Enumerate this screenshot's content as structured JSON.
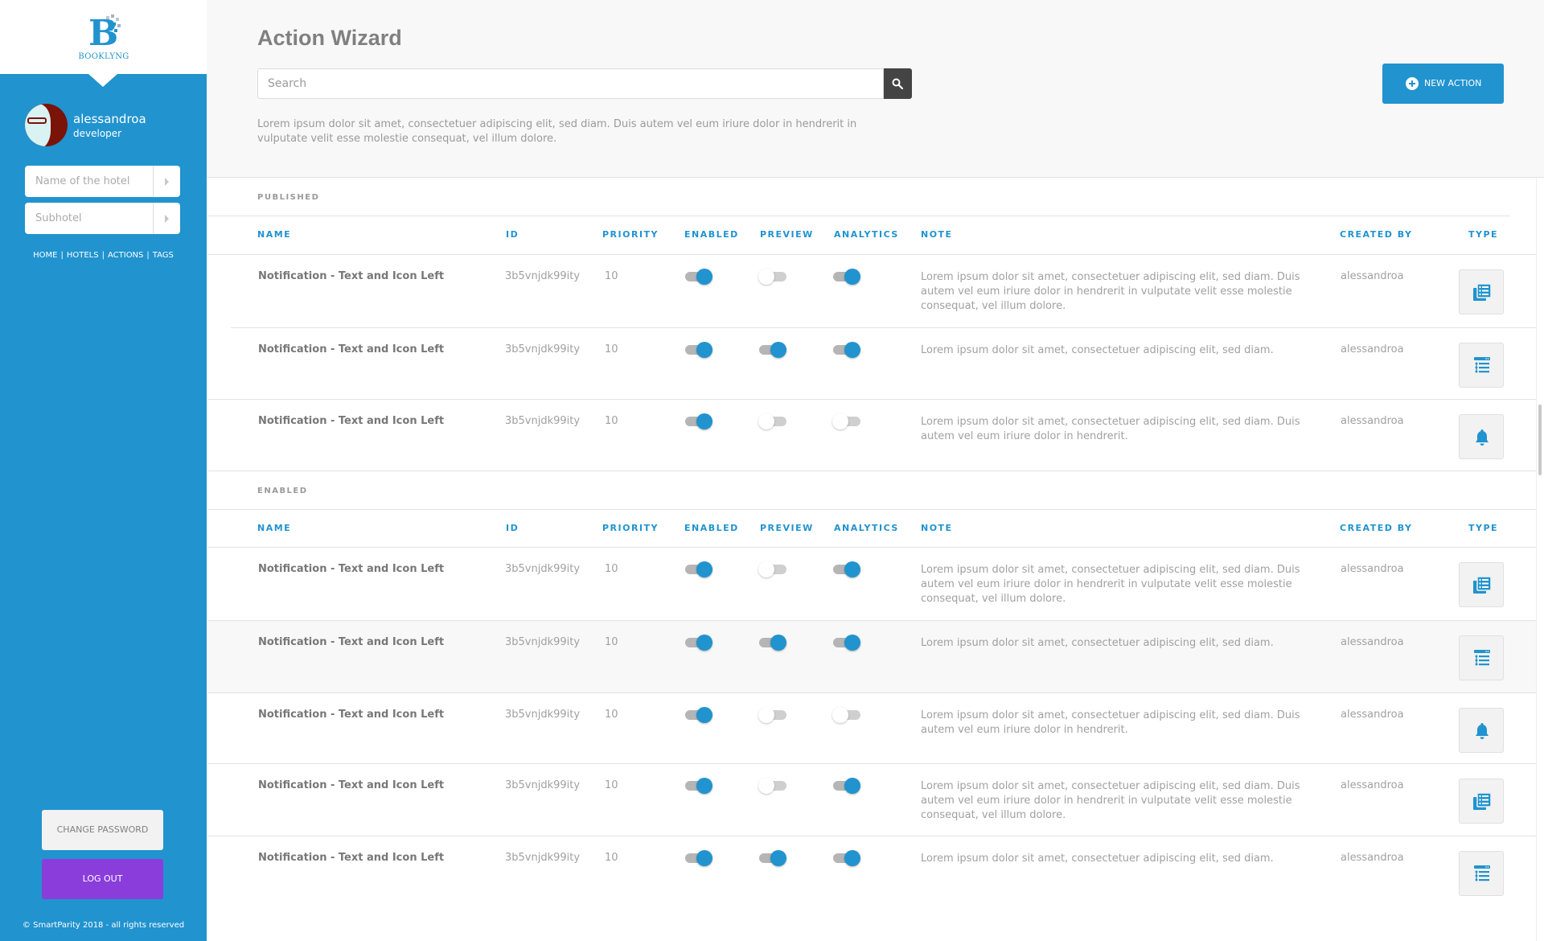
{
  "sidebar": {
    "logo_text": "BOOKLYNG",
    "user": {
      "name": "alessandroa",
      "role": "developer"
    },
    "hotel_input": {
      "placeholder": "Name of the hotel",
      "value": ""
    },
    "subhotel_input": {
      "placeholder": "Subhotel",
      "value": ""
    },
    "nav": [
      {
        "label": "HOME"
      },
      {
        "label": "HOTELS"
      },
      {
        "label": "ACTIONS"
      },
      {
        "label": "TAGS"
      }
    ],
    "nav_separator": "|",
    "change_password_label": "CHANGE PASSWORD",
    "logout_label": "LOG OUT",
    "copyright": "© SmartParity 2018 - all rights reserved"
  },
  "header": {
    "title": "Action Wizard",
    "search": {
      "placeholder": "Search",
      "value": ""
    },
    "description": "Lorem ipsum dolor sit amet, consectetuer adipiscing elit, sed diam. Duis autem vel eum iriure dolor in hendrerit in vulputate velit esse molestie consequat, vel illum dolore.",
    "new_action_label": "NEW ACTION"
  },
  "columns": {
    "name": "NAME",
    "id": "ID",
    "priority": "PRIORITY",
    "enabled": "ENABLED",
    "preview": "PREVIEW",
    "analytics": "ANALYTICS",
    "note": "NOTE",
    "created_by": "CREATED BY",
    "type": "TYPE"
  },
  "colors": {
    "brand_blue": "#2193cf",
    "logout_purple": "#8a3ddb",
    "toggle_on": "#2193cf",
    "toggle_off": "#ffffff"
  },
  "sections": [
    {
      "label": "PUBLISHED",
      "rows": [
        {
          "name": "Notification - Text and Icon Left",
          "id": "3b5vnjdk99ity",
          "priority": "10",
          "enabled": true,
          "preview": false,
          "analytics": true,
          "note": "Lorem ipsum dolor sit amet, consectetuer adipiscing elit, sed diam. Duis autem vel eum iriure dolor in hendrerit in vulputate velit esse molestie consequat, vel illum dolore.",
          "created_by": "alessandroa",
          "type_icon": "layers-list-icon"
        },
        {
          "name": "Notification - Text and Icon Left",
          "id": "3b5vnjdk99ity",
          "priority": "10",
          "enabled": true,
          "preview": true,
          "analytics": true,
          "note": "Lorem ipsum dolor sit amet, consectetuer adipiscing elit, sed diam.",
          "created_by": "alessandroa",
          "type_icon": "window-list-icon"
        },
        {
          "name": "Notification - Text and Icon Left",
          "id": "3b5vnjdk99ity",
          "priority": "10",
          "enabled": true,
          "preview": false,
          "analytics": false,
          "note": "Lorem ipsum dolor sit amet, consectetuer adipiscing elit, sed diam. Duis autem vel eum iriure dolor in hendrerit.",
          "created_by": "alessandroa",
          "type_icon": "bell-icon"
        }
      ]
    },
    {
      "label": "ENABLED",
      "rows": [
        {
          "name": "Notification - Text and Icon Left",
          "id": "3b5vnjdk99ity",
          "priority": "10",
          "enabled": true,
          "preview": false,
          "analytics": true,
          "note": "Lorem ipsum dolor sit amet, consectetuer adipiscing elit, sed diam. Duis autem vel eum iriure dolor in hendrerit in vulputate velit esse molestie consequat, vel illum dolore.",
          "created_by": "alessandroa",
          "type_icon": "layers-list-icon"
        },
        {
          "name": "Notification - Text and Icon Left",
          "id": "3b5vnjdk99ity",
          "priority": "10",
          "enabled": true,
          "preview": true,
          "analytics": true,
          "note": "Lorem ipsum dolor sit amet, consectetuer adipiscing elit, sed diam.",
          "created_by": "alessandroa",
          "type_icon": "window-list-icon",
          "highlighted": true
        },
        {
          "name": "Notification - Text and Icon Left",
          "id": "3b5vnjdk99ity",
          "priority": "10",
          "enabled": true,
          "preview": false,
          "analytics": false,
          "note": "Lorem ipsum dolor sit amet, consectetuer adipiscing elit, sed diam. Duis autem vel eum iriure dolor in hendrerit.",
          "created_by": "alessandroa",
          "type_icon": "bell-icon"
        },
        {
          "name": "Notification - Text and Icon Left",
          "id": "3b5vnjdk99ity",
          "priority": "10",
          "enabled": true,
          "preview": false,
          "analytics": true,
          "note": "Lorem ipsum dolor sit amet, consectetuer adipiscing elit, sed diam. Duis autem vel eum iriure dolor in hendrerit in vulputate velit esse molestie consequat, vel illum dolore.",
          "created_by": "alessandroa",
          "type_icon": "layers-list-icon"
        },
        {
          "name": "Notification - Text and Icon Left",
          "id": "3b5vnjdk99ity",
          "priority": "10",
          "enabled": true,
          "preview": true,
          "analytics": true,
          "note": "Lorem ipsum dolor sit amet, consectetuer adipiscing elit, sed diam.",
          "created_by": "alessandroa",
          "type_icon": "window-list-icon"
        }
      ]
    }
  ]
}
